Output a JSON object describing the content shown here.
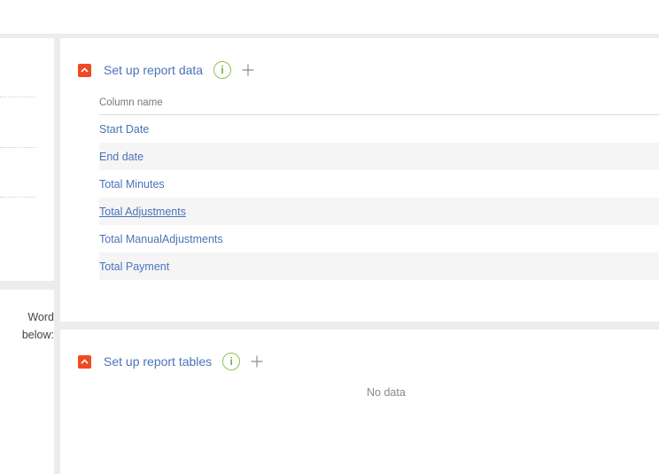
{
  "left_panel": {
    "text_line1": "Word",
    "text_line2": "below:"
  },
  "report_data": {
    "title": "Set up report data",
    "info_icon": "info-icon",
    "add_icon": "plus-icon",
    "column_header": "Column name",
    "rows": [
      "Start Date",
      "End date",
      "Total Minutes",
      "Total Adjustments",
      "Total ManualAdjustments",
      "Total Payment"
    ]
  },
  "report_tables": {
    "title": "Set up report tables",
    "info_icon": "info-icon",
    "add_icon": "plus-icon",
    "empty_text": "No data"
  },
  "colors": {
    "accent_red": "#f04a24",
    "link_blue": "#4a73b8",
    "info_green": "#8cc152"
  }
}
